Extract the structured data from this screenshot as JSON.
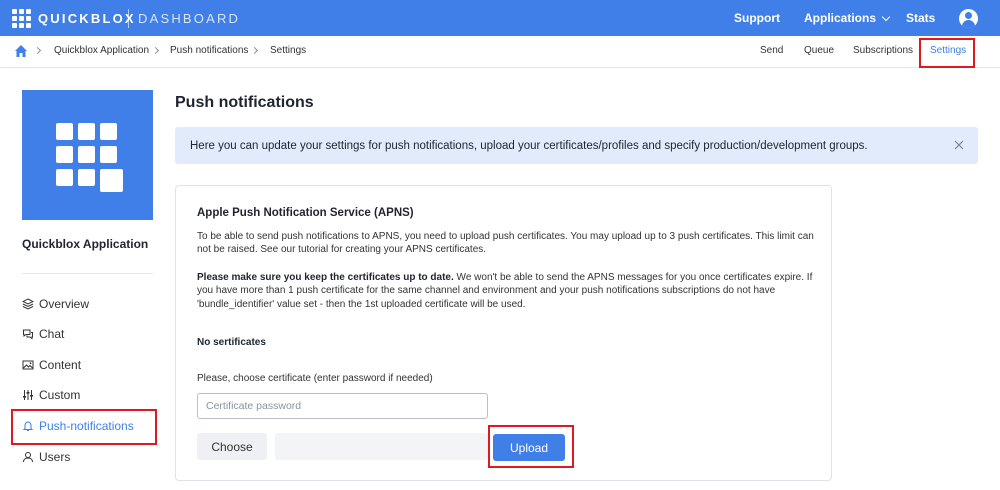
{
  "header": {
    "brand": "QUICKBLOX",
    "brand_sub": "DASHBOARD",
    "nav": {
      "support": "Support",
      "applications": "Applications",
      "stats": "Stats"
    }
  },
  "breadcrumb": {
    "items": [
      "Quickblox Application",
      "Push notifications",
      "Settings"
    ]
  },
  "subnav": {
    "items": [
      "Send",
      "Queue",
      "Subscriptions",
      "Settings"
    ],
    "active": "Settings"
  },
  "sidebar": {
    "app_name": "Quickblox Application",
    "items": [
      {
        "label": "Overview",
        "icon": "layers-icon"
      },
      {
        "label": "Chat",
        "icon": "chat-bubbles-icon"
      },
      {
        "label": "Content",
        "icon": "image-icon"
      },
      {
        "label": "Custom",
        "icon": "sliders-icon"
      },
      {
        "label": "Push-notifications",
        "icon": "bell-icon"
      },
      {
        "label": "Users",
        "icon": "user-icon"
      }
    ],
    "active": "Push-notifications"
  },
  "main": {
    "title": "Push notifications",
    "banner": "Here you can update your settings for push notifications, upload your certificates/profiles and specify production/development groups.",
    "card": {
      "title": "Apple Push Notification Service (APNS)",
      "para1": "To be able to send push notifications to APNS, you need to upload push certificates. You may upload up to 3 push certificates. This limit can not be raised. See our tutorial for creating your APNS certificates.",
      "para2_bold": "Please make sure you keep the certificates up to date.",
      "para2_rest": " We won't be able to send the APNS messages for you once certificates expire. If you have more than 1 push certificate for the same channel and environment and your push notifications subscriptions do not have 'bundle_identifier' value set - then the 1st uploaded certificate will be used.",
      "no_certs": "No sertificates",
      "choose_label": "Please, choose certificate (enter password if needed)",
      "password_placeholder": "Certificate password",
      "password_value": "",
      "choose_button": "Choose",
      "upload_button": "Upload"
    }
  },
  "colors": {
    "accent": "#3f7fe7",
    "banner_bg": "#e1ebfb",
    "highlight_box": "#e0191e"
  }
}
